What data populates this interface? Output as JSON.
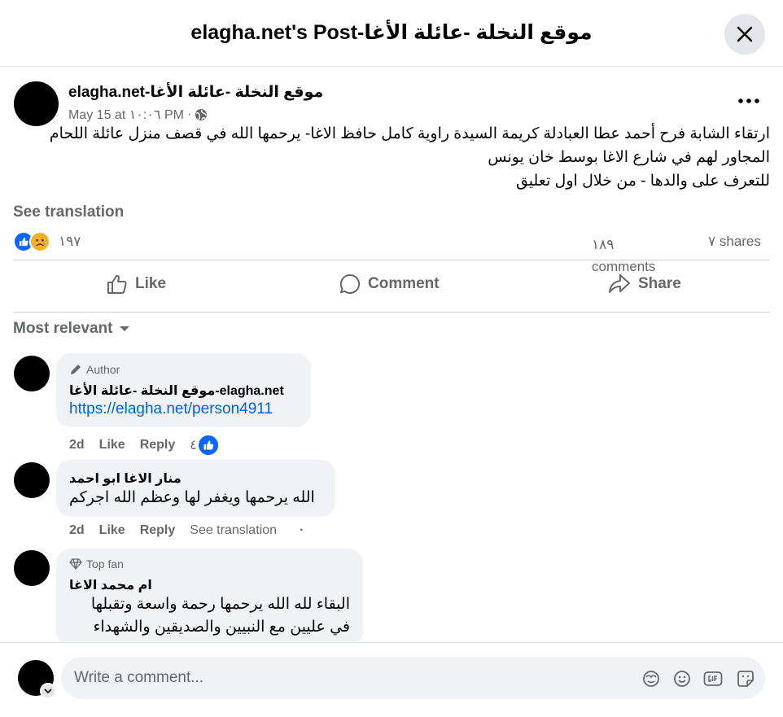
{
  "header": {
    "title": "elagha.net's Post-موقع النخلة -عائلة الأغا"
  },
  "post": {
    "author": "elagha.net-موقع النخلة -عائلة الأغا",
    "date": "May 15 at ١٠:٠٦ PM",
    "separator": "·",
    "body_lines": [
      "ارتقاء الشابة فرح أحمد عطا العبادلة كريمة السيدة راوية كامل حافظ الاغا- يرحمها الله في قصف منزل عائلة اللحام",
      "المجاور لهم في شارع الاغا بوسط خان يونس",
      "للتعرف على والدها - من خلال اول تعليق"
    ],
    "see_translation": "See translation",
    "reaction_count": "١٩٧",
    "comments_count": "١٨٩ comments",
    "shares_count": "٧ shares"
  },
  "actions": {
    "like": "Like",
    "comment": "Comment",
    "share": "Share"
  },
  "sort_label": "Most relevant",
  "comments": [
    {
      "badge": "Author",
      "name": "موقع النخلة -عائلة الأغا-elagha.net",
      "link": "https://elagha.net/person4911",
      "time": "2d",
      "like": "Like",
      "reply": "Reply",
      "reaction_count": "٤"
    },
    {
      "name": "منار الاغا ابو احمد",
      "text": "الله يرحمها ويغفر لها وعظم الله اجركم",
      "time": "2d",
      "like": "Like",
      "reply": "Reply",
      "see_translation": "See translation",
      "dot": "·"
    },
    {
      "badge": "Top fan",
      "name": "ام محمد الاغا",
      "text_lines": [
        "البقاء لله الله يرحمها رحمة واسعة وتقبلها",
        "في عليين مع النبيين والصديقين والشهداء"
      ]
    }
  ],
  "composer": {
    "placeholder": "Write a comment..."
  },
  "icons": {
    "close": "close-icon",
    "more": "more-icon",
    "globe": "globe-icon",
    "like_reaction": "like-reaction-icon",
    "sad_reaction": "sad-reaction-icon",
    "like": "thumbs-up-icon",
    "comment": "comment-icon",
    "share": "share-icon",
    "dropdown": "caret-down-icon",
    "author_badge": "pen-icon",
    "topfan_badge": "diamond-icon",
    "avatar_sticker": "avatar-sticker-icon",
    "emoji": "emoji-icon",
    "gif": "gif-icon",
    "sticker": "sticker-icon"
  },
  "colors": {
    "accent": "#0866ff",
    "link": "#0064d1",
    "muted": "#65676b",
    "bubble": "#f0f2f5",
    "sad": "#f7b125"
  }
}
